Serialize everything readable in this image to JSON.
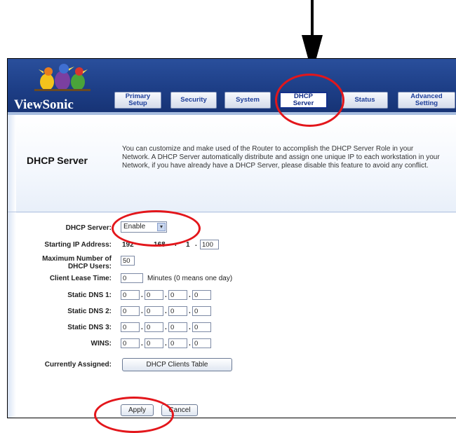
{
  "brand": {
    "logo_text": "ViewSonic"
  },
  "tabs": [
    {
      "label": "Primary\nSetup"
    },
    {
      "label": "Security"
    },
    {
      "label": "System"
    },
    {
      "label": "DHCP\nServer"
    },
    {
      "label": "Status"
    },
    {
      "label": "Advanced\nSetting"
    }
  ],
  "page": {
    "title": "DHCP Server",
    "intro": "You can customize and make used of the Router to accomplish the DHCP Server Role in your Network. A DHCP Server automatically distribute and assign one unique IP to each workstation in your Network, if you have already have a DHCP Server, please disable this feature to avoid any conflict."
  },
  "form": {
    "dhcp_server": {
      "label": "DHCP Server:",
      "value": "Enable"
    },
    "starting_ip": {
      "label": "Starting IP Address:",
      "octets": [
        "192",
        "168",
        "1"
      ],
      "last": "100"
    },
    "max_users": {
      "label_line1": "Maximum Number of",
      "label_line2": "DHCP Users:",
      "value": "50"
    },
    "lease_time": {
      "label": "Client Lease Time:",
      "value": "0",
      "hint": "Minutes (0 means one day)"
    },
    "static_dns1": {
      "label": "Static DNS 1:",
      "octets": [
        "0",
        "0",
        "0",
        "0"
      ]
    },
    "static_dns2": {
      "label": "Static DNS 2:",
      "octets": [
        "0",
        "0",
        "0",
        "0"
      ]
    },
    "static_dns3": {
      "label": "Static DNS 3:",
      "octets": [
        "0",
        "0",
        "0",
        "0"
      ]
    },
    "wins": {
      "label": "WINS:",
      "octets": [
        "0",
        "0",
        "0",
        "0"
      ]
    },
    "assigned": {
      "label": "Currently Assigned:",
      "button": "DHCP Clients Table"
    },
    "apply": "Apply",
    "cancel": "Cancel"
  },
  "colors": {
    "header": "#1d3e86",
    "annotation_ring": "#e3161b",
    "tab_text": "#1d3e9a"
  },
  "icons": {
    "dropdown": "chevron-down-icon",
    "arrow": "arrow-down-icon"
  }
}
